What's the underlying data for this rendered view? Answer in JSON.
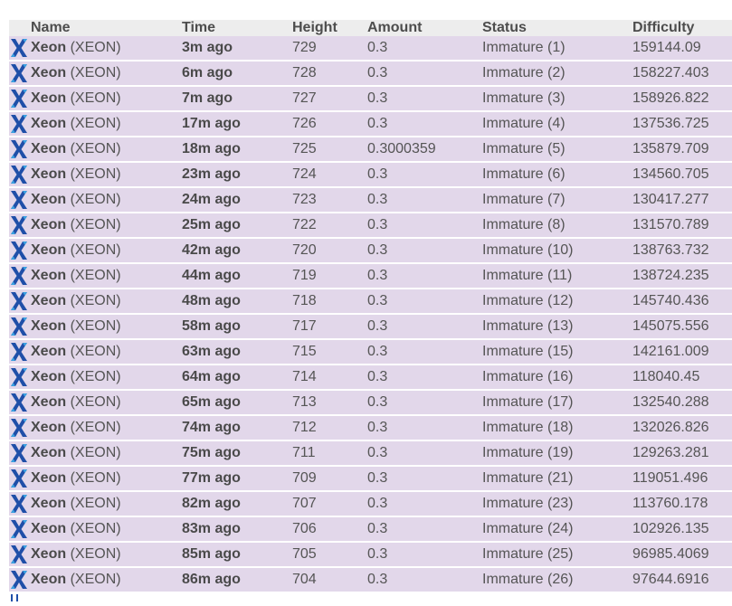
{
  "columns": {
    "name": "Name",
    "time": "Time",
    "height": "Height",
    "amount": "Amount",
    "status": "Status",
    "difficulty": "Difficulty"
  },
  "colors": {
    "row_background": "#e2d7ea",
    "header_background": "#ededed",
    "icon_blue": "#1f4fa8",
    "icon_light_blue": "#3aa0e0"
  },
  "icon": "xeon-coin-icon",
  "rows": [
    {
      "name": "Xeon",
      "symbol": "(XEON)",
      "time": "3m ago",
      "height": "729",
      "amount": "0.3",
      "status": "Immature (1)",
      "difficulty": "159144.09"
    },
    {
      "name": "Xeon",
      "symbol": "(XEON)",
      "time": "6m ago",
      "height": "728",
      "amount": "0.3",
      "status": "Immature (2)",
      "difficulty": "158227.403"
    },
    {
      "name": "Xeon",
      "symbol": "(XEON)",
      "time": "7m ago",
      "height": "727",
      "amount": "0.3",
      "status": "Immature (3)",
      "difficulty": "158926.822"
    },
    {
      "name": "Xeon",
      "symbol": "(XEON)",
      "time": "17m ago",
      "height": "726",
      "amount": "0.3",
      "status": "Immature (4)",
      "difficulty": "137536.725"
    },
    {
      "name": "Xeon",
      "symbol": "(XEON)",
      "time": "18m ago",
      "height": "725",
      "amount": "0.3000359",
      "status": "Immature (5)",
      "difficulty": "135879.709"
    },
    {
      "name": "Xeon",
      "symbol": "(XEON)",
      "time": "23m ago",
      "height": "724",
      "amount": "0.3",
      "status": "Immature (6)",
      "difficulty": "134560.705"
    },
    {
      "name": "Xeon",
      "symbol": "(XEON)",
      "time": "24m ago",
      "height": "723",
      "amount": "0.3",
      "status": "Immature (7)",
      "difficulty": "130417.277"
    },
    {
      "name": "Xeon",
      "symbol": "(XEON)",
      "time": "25m ago",
      "height": "722",
      "amount": "0.3",
      "status": "Immature (8)",
      "difficulty": "131570.789"
    },
    {
      "name": "Xeon",
      "symbol": "(XEON)",
      "time": "42m ago",
      "height": "720",
      "amount": "0.3",
      "status": "Immature (10)",
      "difficulty": "138763.732"
    },
    {
      "name": "Xeon",
      "symbol": "(XEON)",
      "time": "44m ago",
      "height": "719",
      "amount": "0.3",
      "status": "Immature (11)",
      "difficulty": "138724.235"
    },
    {
      "name": "Xeon",
      "symbol": "(XEON)",
      "time": "48m ago",
      "height": "718",
      "amount": "0.3",
      "status": "Immature (12)",
      "difficulty": "145740.436"
    },
    {
      "name": "Xeon",
      "symbol": "(XEON)",
      "time": "58m ago",
      "height": "717",
      "amount": "0.3",
      "status": "Immature (13)",
      "difficulty": "145075.556"
    },
    {
      "name": "Xeon",
      "symbol": "(XEON)",
      "time": "63m ago",
      "height": "715",
      "amount": "0.3",
      "status": "Immature (15)",
      "difficulty": "142161.009"
    },
    {
      "name": "Xeon",
      "symbol": "(XEON)",
      "time": "64m ago",
      "height": "714",
      "amount": "0.3",
      "status": "Immature (16)",
      "difficulty": "118040.45"
    },
    {
      "name": "Xeon",
      "symbol": "(XEON)",
      "time": "65m ago",
      "height": "713",
      "amount": "0.3",
      "status": "Immature (17)",
      "difficulty": "132540.288"
    },
    {
      "name": "Xeon",
      "symbol": "(XEON)",
      "time": "74m ago",
      "height": "712",
      "amount": "0.3",
      "status": "Immature (18)",
      "difficulty": "132026.826"
    },
    {
      "name": "Xeon",
      "symbol": "(XEON)",
      "time": "75m ago",
      "height": "711",
      "amount": "0.3",
      "status": "Immature (19)",
      "difficulty": "129263.281"
    },
    {
      "name": "Xeon",
      "symbol": "(XEON)",
      "time": "77m ago",
      "height": "709",
      "amount": "0.3",
      "status": "Immature (21)",
      "difficulty": "119051.496"
    },
    {
      "name": "Xeon",
      "symbol": "(XEON)",
      "time": "82m ago",
      "height": "707",
      "amount": "0.3",
      "status": "Immature (23)",
      "difficulty": "113760.178"
    },
    {
      "name": "Xeon",
      "symbol": "(XEON)",
      "time": "83m ago",
      "height": "706",
      "amount": "0.3",
      "status": "Immature (24)",
      "difficulty": "102926.135"
    },
    {
      "name": "Xeon",
      "symbol": "(XEON)",
      "time": "85m ago",
      "height": "705",
      "amount": "0.3",
      "status": "Immature (25)",
      "difficulty": "96985.4069"
    },
    {
      "name": "Xeon",
      "symbol": "(XEON)",
      "time": "86m ago",
      "height": "704",
      "amount": "0.3",
      "status": "Immature (26)",
      "difficulty": "97644.6916"
    }
  ]
}
